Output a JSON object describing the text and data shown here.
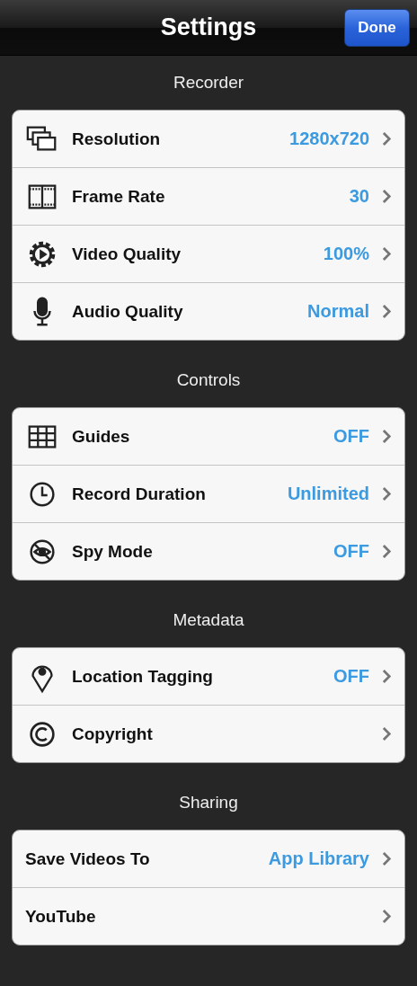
{
  "nav_bar": {
    "title": "Settings",
    "done_button": "Done"
  },
  "sections": [
    {
      "header": "Recorder",
      "rows": [
        {
          "label": "Resolution",
          "value": "1280x720"
        },
        {
          "label": "Frame Rate",
          "value": "30"
        },
        {
          "label": "Video Quality",
          "value": "100%"
        },
        {
          "label": "Audio Quality",
          "value": "Normal"
        }
      ]
    },
    {
      "header": "Controls",
      "rows": [
        {
          "label": "Guides",
          "value": "OFF"
        },
        {
          "label": "Record Duration",
          "value": "Unlimited"
        },
        {
          "label": "Spy Mode",
          "value": "OFF"
        }
      ]
    },
    {
      "header": "Metadata",
      "rows": [
        {
          "label": "Location Tagging",
          "value": "OFF"
        },
        {
          "label": "Copyright"
        }
      ]
    },
    {
      "header": "Sharing",
      "rows": [
        {
          "label": "Save Videos To",
          "value": "App Library"
        },
        {
          "label": "YouTube"
        }
      ]
    }
  ]
}
